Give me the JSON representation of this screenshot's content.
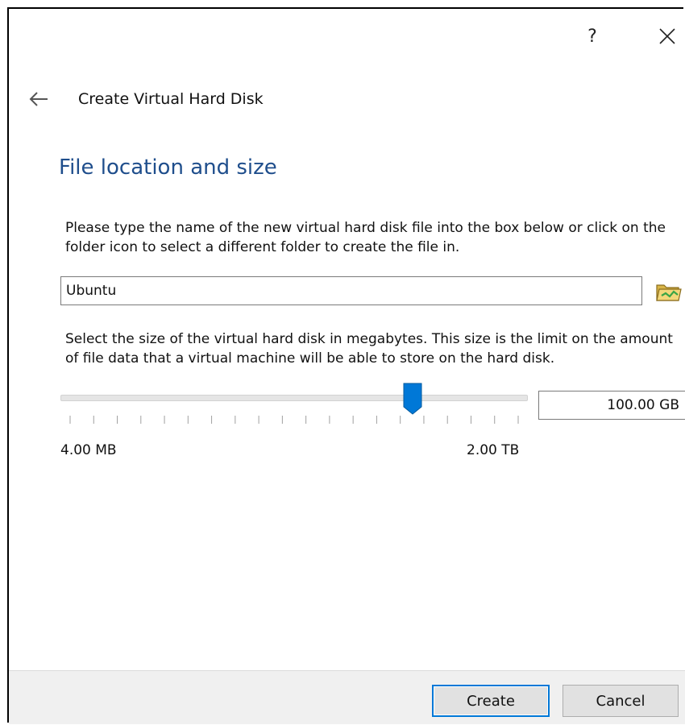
{
  "titlebar": {
    "help_label": "?"
  },
  "wizard": {
    "title": "Create Virtual Hard Disk",
    "heading": "File location and size",
    "location_description": "Please type the name of the new virtual hard disk file into the box below or click on the folder icon to select a different folder to create the file in.",
    "file_name_value": "Ubuntu",
    "size_description": "Select the size of the virtual hard disk in megabytes. This size is the limit on the amount of file data that a virtual machine will be able to store on the hard disk.",
    "size_value": "100.00 GB",
    "slider": {
      "min_label": "4.00 MB",
      "max_label": "2.00 TB",
      "level_fraction": 0.75,
      "tick_count": 20
    }
  },
  "buttons": {
    "create_label": "Create",
    "cancel_label": "Cancel"
  },
  "icons": {
    "back": "back-arrow-icon",
    "close": "close-icon",
    "folder": "folder-icon"
  },
  "colors": {
    "heading": "#1f4e8c",
    "accent": "#0078d7"
  }
}
